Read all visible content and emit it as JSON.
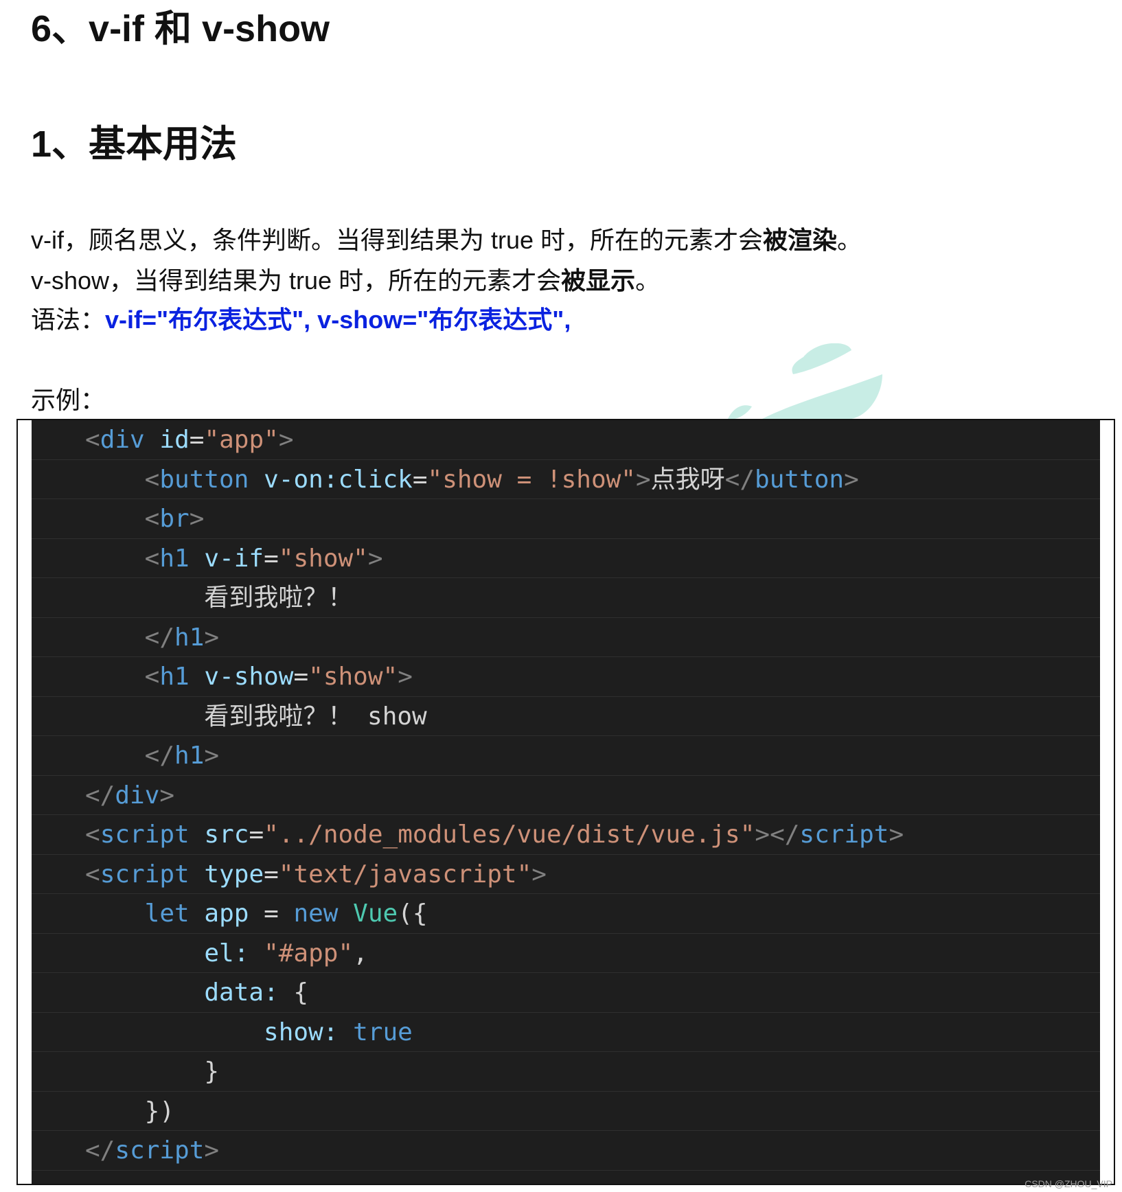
{
  "document": {
    "title": "6、v-if 和 v-show",
    "section_heading": "1、基本用法",
    "paragraph1": {
      "prefix": "v-if，顾名思义，条件判断。当得到结果为 true 时，所在的元素才会",
      "emphasis": "被渲染",
      "suffix": "。"
    },
    "paragraph2": {
      "prefix": "v-show，当得到结果为 true 时，所在的元素才会",
      "emphasis": "被显示",
      "suffix": "。"
    },
    "syntax": {
      "label": "语法：",
      "value": "v-if=\"布尔表达式\", v-show=\"布尔表达式\","
    },
    "example_label": "示例："
  },
  "code_block": {
    "lines": [
      {
        "indent": 2,
        "tokens": [
          {
            "t": "punct",
            "v": "<"
          },
          {
            "t": "tag",
            "v": "div"
          },
          {
            "t": "txt",
            "v": " "
          },
          {
            "t": "attr",
            "v": "id"
          },
          {
            "t": "txt",
            "v": "="
          },
          {
            "t": "str",
            "v": "\"app\""
          },
          {
            "t": "punct",
            "v": ">"
          }
        ]
      },
      {
        "indent": 4,
        "tokens": [
          {
            "t": "punct",
            "v": "<"
          },
          {
            "t": "tag",
            "v": "button"
          },
          {
            "t": "txt",
            "v": " "
          },
          {
            "t": "attr",
            "v": "v-on:click"
          },
          {
            "t": "txt",
            "v": "="
          },
          {
            "t": "str",
            "v": "\"show = !show\""
          },
          {
            "t": "punct",
            "v": ">"
          },
          {
            "t": "txt",
            "v": "点我呀"
          },
          {
            "t": "punct",
            "v": "</"
          },
          {
            "t": "tag",
            "v": "button"
          },
          {
            "t": "punct",
            "v": ">"
          }
        ]
      },
      {
        "indent": 4,
        "tokens": [
          {
            "t": "punct",
            "v": "<"
          },
          {
            "t": "tag",
            "v": "br"
          },
          {
            "t": "punct",
            "v": ">"
          }
        ]
      },
      {
        "indent": 4,
        "tokens": [
          {
            "t": "punct",
            "v": "<"
          },
          {
            "t": "tag",
            "v": "h1"
          },
          {
            "t": "txt",
            "v": " "
          },
          {
            "t": "attr",
            "v": "v-if"
          },
          {
            "t": "txt",
            "v": "="
          },
          {
            "t": "str",
            "v": "\"show\""
          },
          {
            "t": "punct",
            "v": ">"
          }
        ]
      },
      {
        "indent": 6,
        "tokens": [
          {
            "t": "txt",
            "v": "看到我啦？！"
          }
        ]
      },
      {
        "indent": 4,
        "tokens": [
          {
            "t": "punct",
            "v": "</"
          },
          {
            "t": "tag",
            "v": "h1"
          },
          {
            "t": "punct",
            "v": ">"
          }
        ]
      },
      {
        "indent": 4,
        "tokens": [
          {
            "t": "punct",
            "v": "<"
          },
          {
            "t": "tag",
            "v": "h1"
          },
          {
            "t": "txt",
            "v": " "
          },
          {
            "t": "attr",
            "v": "v-show"
          },
          {
            "t": "txt",
            "v": "="
          },
          {
            "t": "str",
            "v": "\"show\""
          },
          {
            "t": "punct",
            "v": ">"
          }
        ]
      },
      {
        "indent": 6,
        "tokens": [
          {
            "t": "txt",
            "v": "看到我啦？！ show"
          }
        ]
      },
      {
        "indent": 4,
        "tokens": [
          {
            "t": "punct",
            "v": "</"
          },
          {
            "t": "tag",
            "v": "h1"
          },
          {
            "t": "punct",
            "v": ">"
          }
        ]
      },
      {
        "indent": 2,
        "tokens": [
          {
            "t": "punct",
            "v": "</"
          },
          {
            "t": "tag",
            "v": "div"
          },
          {
            "t": "punct",
            "v": ">"
          }
        ]
      },
      {
        "indent": 2,
        "tokens": [
          {
            "t": "punct",
            "v": "<"
          },
          {
            "t": "tag",
            "v": "script"
          },
          {
            "t": "txt",
            "v": " "
          },
          {
            "t": "attr",
            "v": "src"
          },
          {
            "t": "txt",
            "v": "="
          },
          {
            "t": "str",
            "v": "\"../node_modules/vue/dist/vue.js\""
          },
          {
            "t": "punct",
            "v": "></"
          },
          {
            "t": "tag",
            "v": "script"
          },
          {
            "t": "punct",
            "v": ">"
          }
        ]
      },
      {
        "indent": 2,
        "tokens": [
          {
            "t": "punct",
            "v": "<"
          },
          {
            "t": "tag",
            "v": "script"
          },
          {
            "t": "txt",
            "v": " "
          },
          {
            "t": "attr",
            "v": "type"
          },
          {
            "t": "txt",
            "v": "="
          },
          {
            "t": "str",
            "v": "\"text/javascript\""
          },
          {
            "t": "punct",
            "v": ">"
          }
        ]
      },
      {
        "indent": 4,
        "tokens": [
          {
            "t": "kw",
            "v": "let"
          },
          {
            "t": "txt",
            "v": " "
          },
          {
            "t": "prop",
            "v": "app"
          },
          {
            "t": "txt",
            "v": " = "
          },
          {
            "t": "kw",
            "v": "new"
          },
          {
            "t": "txt",
            "v": " "
          },
          {
            "t": "cls",
            "v": "Vue"
          },
          {
            "t": "txt",
            "v": "({"
          }
        ]
      },
      {
        "indent": 6,
        "tokens": [
          {
            "t": "prop",
            "v": "el:"
          },
          {
            "t": "txt",
            "v": " "
          },
          {
            "t": "str",
            "v": "\"#app\""
          },
          {
            "t": "txt",
            "v": ","
          }
        ]
      },
      {
        "indent": 6,
        "tokens": [
          {
            "t": "prop",
            "v": "data:"
          },
          {
            "t": "txt",
            "v": " {"
          }
        ]
      },
      {
        "indent": 8,
        "tokens": [
          {
            "t": "prop",
            "v": "show:"
          },
          {
            "t": "txt",
            "v": " "
          },
          {
            "t": "kw",
            "v": "true"
          }
        ]
      },
      {
        "indent": 6,
        "tokens": [
          {
            "t": "txt",
            "v": "}"
          }
        ]
      },
      {
        "indent": 4,
        "tokens": [
          {
            "t": "txt",
            "v": "})"
          }
        ]
      },
      {
        "indent": 2,
        "tokens": [
          {
            "t": "punct",
            "v": "</"
          },
          {
            "t": "tag",
            "v": "script"
          },
          {
            "t": "punct",
            "v": ">"
          }
        ]
      }
    ]
  },
  "watermark": {
    "text": "CSDN @ZHOU_VIP"
  },
  "colors": {
    "syntax_highlight": "#0a22e0",
    "code_background": "#1e1e1e",
    "tag": "#569cd6",
    "attribute": "#9cdcfe",
    "string": "#ce9178",
    "class_name": "#4ec9b0",
    "logo": "#c8ede5"
  }
}
